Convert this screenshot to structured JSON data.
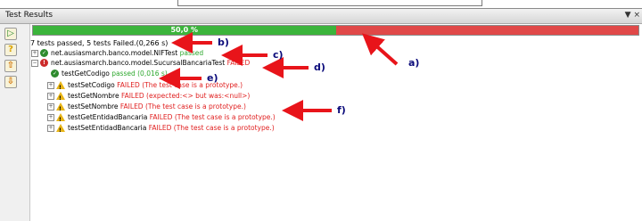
{
  "panel": {
    "title": "Test Results",
    "title_icon": "pin-menu-icon"
  },
  "toolbar": {
    "buttons": [
      {
        "name": "rerun-icon",
        "glyph": "▷"
      },
      {
        "name": "filter-icon",
        "glyph": "?"
      },
      {
        "name": "prev-failure-icon",
        "glyph": "⇧"
      },
      {
        "name": "next-failure-icon",
        "glyph": "⇩"
      }
    ]
  },
  "progress": {
    "label": "50,0 %",
    "passed_fraction": 0.5,
    "colors": {
      "pass": "#3bb43b",
      "fail": "#e04848"
    }
  },
  "summary": "7 tests passed, 5 tests Failed.(0,266 s)",
  "tree": {
    "nodes": [
      {
        "label": "net.ausiasmarch.banco.model.NIFTest",
        "status": "passed",
        "detail": "",
        "icon": "passed-icon"
      },
      {
        "label": "net.ausiasmarch.banco.model.SucursalBancariaTest",
        "status": "FAILED",
        "detail": "",
        "icon": "error-icon"
      },
      {
        "label": "testGetCodigo",
        "status": "passed",
        "detail": "(0,016 s)",
        "icon": "passed-icon"
      },
      {
        "label": "testSetCodigo",
        "status": "FAILED",
        "detail": "(The test case is a prototype.)",
        "icon": "warning-icon"
      },
      {
        "label": "testGetNombre",
        "status": "FAILED",
        "detail": "(expected:<> but was:<null>)",
        "icon": "warning-icon"
      },
      {
        "label": "testSetNombre",
        "status": "FAILED",
        "detail": "(The test case is a prototype.)",
        "icon": "warning-icon"
      },
      {
        "label": "testGetEntidadBancaria",
        "status": "FAILED",
        "detail": "(The test case is a prototype.)",
        "icon": "warning-icon"
      },
      {
        "label": "testSetEntidadBancaria",
        "status": "FAILED",
        "detail": "(The test case is a prototype.)",
        "icon": "warning-icon"
      }
    ]
  },
  "annotations": [
    "a)",
    "b)",
    "c)",
    "d)",
    "e)",
    "f)"
  ],
  "annotation_arrow_color": "#e8141a"
}
